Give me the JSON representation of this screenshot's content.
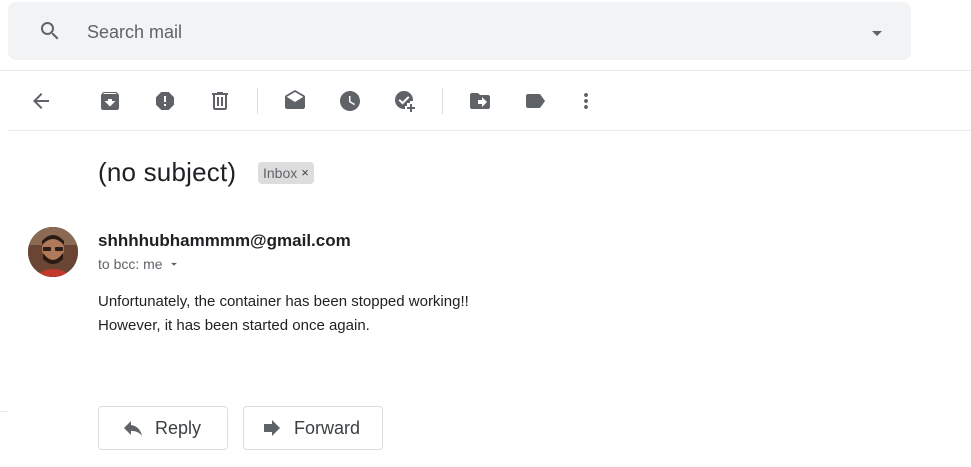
{
  "search": {
    "placeholder": "Search mail",
    "icon": "search-icon",
    "options_icon": "caret-down-icon"
  },
  "toolbar": {
    "icons": [
      "back-arrow-icon",
      "archive-icon",
      "report-spam-icon",
      "delete-icon",
      "mark-unread-icon",
      "snooze-icon",
      "add-to-tasks-icon",
      "move-to-icon",
      "label-icon",
      "more-options-icon"
    ]
  },
  "email": {
    "subject": "(no subject)",
    "label": "Inbox",
    "label_remove": "×",
    "sender": "shhhhubhammmm@gmail.com",
    "recipient": "to bcc: me",
    "body_line1": "Unfortunately, the container has been stopped working!!",
    "body_line2": "However, it has been started once again."
  },
  "actions": {
    "reply": "Reply",
    "forward": "Forward"
  },
  "colors": {
    "icon": "#5f6368",
    "search_bg": "#f1f3f4",
    "chip_bg": "#dddddd",
    "border": "#dadce0"
  }
}
